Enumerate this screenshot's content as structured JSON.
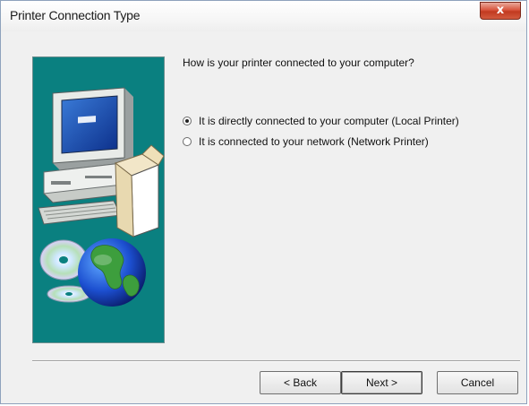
{
  "window": {
    "title": "Printer Connection Type",
    "close_label": "x"
  },
  "content": {
    "question": "How is your printer connected to your computer?",
    "options": [
      {
        "label": "It is directly connected to your computer (Local Printer)",
        "selected": true
      },
      {
        "label": "It is connected to your network (Network Printer)",
        "selected": false
      }
    ]
  },
  "buttons": {
    "back": "< Back",
    "next": "Next >",
    "cancel": "Cancel"
  },
  "illustration": {
    "panel_color": "#0a8080",
    "icons": [
      "computer-icon",
      "cd-disc-icon",
      "globe-icon",
      "package-box-icon"
    ]
  }
}
